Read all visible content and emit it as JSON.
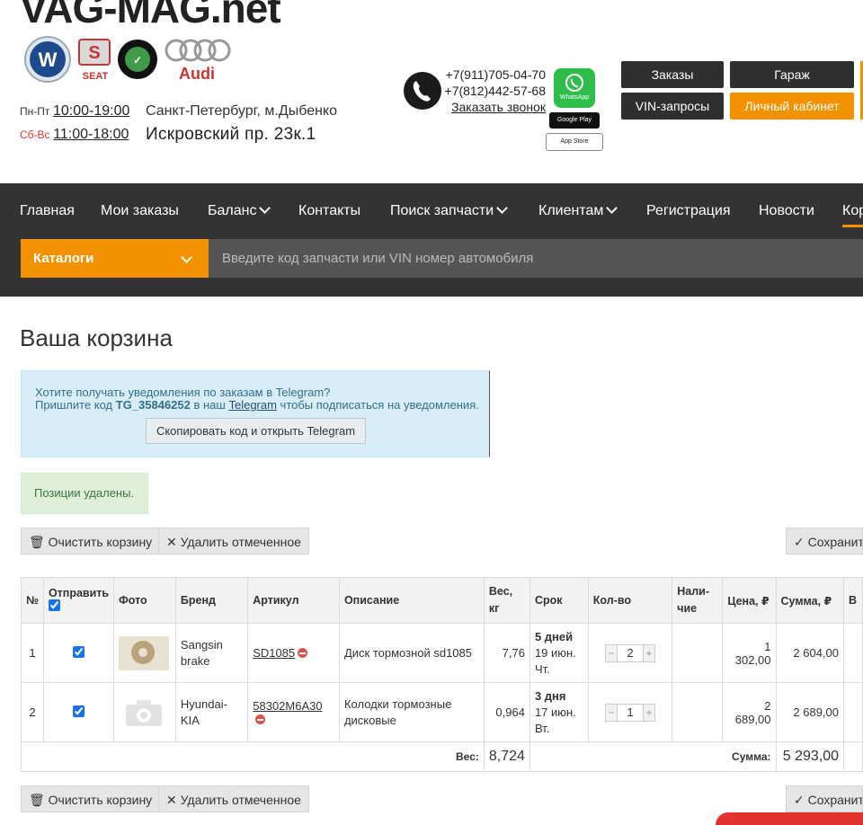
{
  "header": {
    "site_logo": "VAG-MAG.net",
    "brands": [
      "VW",
      "SEAT",
      "ŠKODA AUTO",
      "Audi"
    ],
    "hours": [
      {
        "days": "Пн-Пт",
        "open": "10:00",
        "close": "19:00",
        "sep": "-"
      },
      {
        "days": "Сб-Вс",
        "open": "11:00",
        "close": "18:00",
        "sep": "-"
      }
    ],
    "address_city": "Санкт-Петербург, м.Дыбенко",
    "address_street": "Искровский пр. 23к.1",
    "phones": [
      "+7(911)705-04-70",
      "+7(812)442-57-68"
    ],
    "callback_link": "Заказать звонок",
    "whatsapp_label": "WhatsApp",
    "google_play_label": "Google Play",
    "app_store_label": "App Store",
    "buttons": {
      "orders": "Заказы",
      "garage": "Гараж",
      "vin": "VIN-запросы",
      "cabinet": "Личный кабинет"
    }
  },
  "nav": {
    "items": [
      "Главная",
      "Мои заказы",
      "Баланс",
      "Контакты",
      "Поиск запчасти",
      "Клиентам",
      "Регистрация",
      "Новости",
      "Кор"
    ],
    "catalog_label": "Каталоги",
    "search_placeholder": "Введите код запчасти или VIN номер автомобиля"
  },
  "page": {
    "title": "Ваша корзина",
    "telegram": {
      "line1": "Хотите получать уведомления по заказам в Telegram?",
      "line2_pre": "Пришлите код ",
      "code": "TG_35846252",
      "line2_mid": " в наш ",
      "link": "Telegram",
      "line2_post": " чтобы подписаться на уведомления.",
      "button": "Скопировать код и открыть Telegram"
    },
    "alert": "Позиции удалены.",
    "clear_btn": "Очистить корзину",
    "delete_btn": "Удалить отмеченное",
    "save_btn": "Сохранит"
  },
  "table": {
    "headers": {
      "num": "№",
      "send": "Отправить",
      "photo": "Фото",
      "brand": "Бренд",
      "article": "Артикул",
      "desc": "Описание",
      "weight1": "Вес,",
      "weight2": "кг",
      "term": "Срок",
      "qty": "Кол-во",
      "avail1": "Нали-",
      "avail2": "чие",
      "price": "Цена, ₽",
      "sum": "Сумма, ₽",
      "extra": "В"
    },
    "rows": [
      {
        "num": "1",
        "brand1": "Sangsin",
        "brand2": "brake",
        "article": "SD1085",
        "desc1": "Диск тормозной sd1085",
        "desc2": "",
        "weight": "7,76",
        "term_days": "5 дней",
        "term_date": "19 июн.",
        "term_dow": "Чт.",
        "qty": "2",
        "price": "1 302,00",
        "sum": "2 604,00"
      },
      {
        "num": "2",
        "brand1": "Hyundai-KIA",
        "brand2": "",
        "article": "58302M6A30",
        "desc1": "Колодки тормозные",
        "desc2": "дисковые",
        "weight": "0,964",
        "term_days": "3 дня",
        "term_date": "17 июн.",
        "term_dow": "Вт.",
        "qty": "1",
        "price": "2 689,00",
        "sum": "2 689,00"
      }
    ],
    "total_weight_label": "Вес:",
    "total_weight": "8,724",
    "total_sum_label": "Сумма:",
    "total_sum": "5 293,00"
  },
  "colors": {
    "accent": "#f39200",
    "nav_bg": "#333333",
    "info_bg": "#d9edf7",
    "success_bg": "#dff0d8"
  },
  "icons": [
    "phone-icon",
    "whatsapp-icon",
    "google-play-icon",
    "app-store-icon",
    "chevron-down-icon",
    "trash-icon",
    "x-icon",
    "check-icon",
    "delete-icon",
    "camera-icon"
  ]
}
